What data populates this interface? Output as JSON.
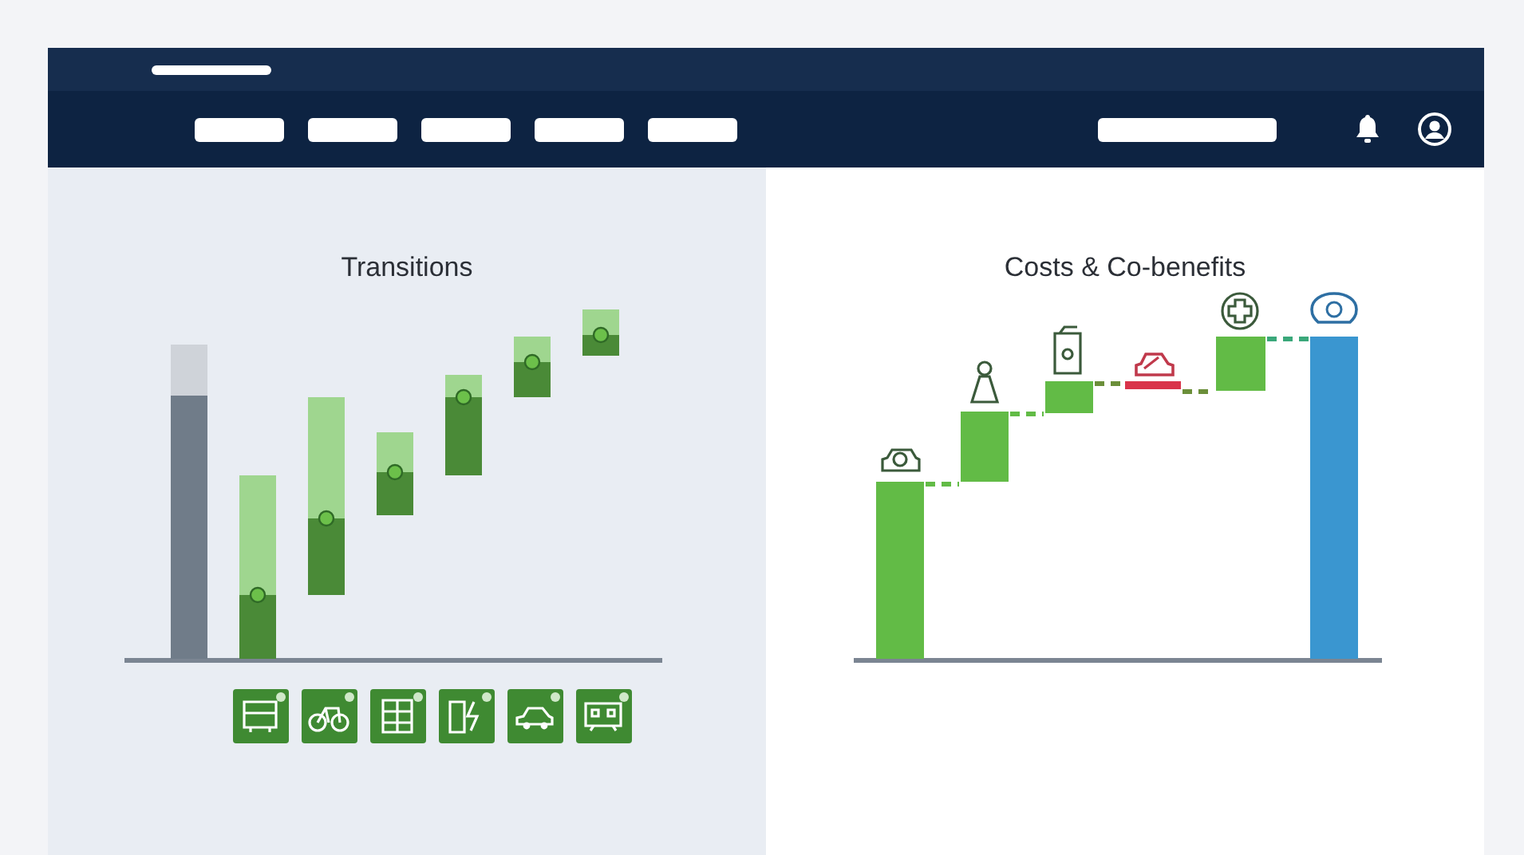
{
  "header": {
    "logo": {
      "kind": "placeholder"
    },
    "nav_items": [
      {
        "kind": "placeholder"
      },
      {
        "kind": "placeholder"
      },
      {
        "kind": "placeholder"
      },
      {
        "kind": "placeholder"
      },
      {
        "kind": "placeholder"
      }
    ],
    "search": {
      "kind": "placeholder"
    },
    "actions": [
      {
        "kind": "bell"
      },
      {
        "kind": "profile"
      }
    ]
  },
  "panels": [
    {
      "title": "Transitions",
      "kind": "transitions"
    },
    {
      "title": "Costs & Co-benefits",
      "kind": "costs"
    }
  ]
}
